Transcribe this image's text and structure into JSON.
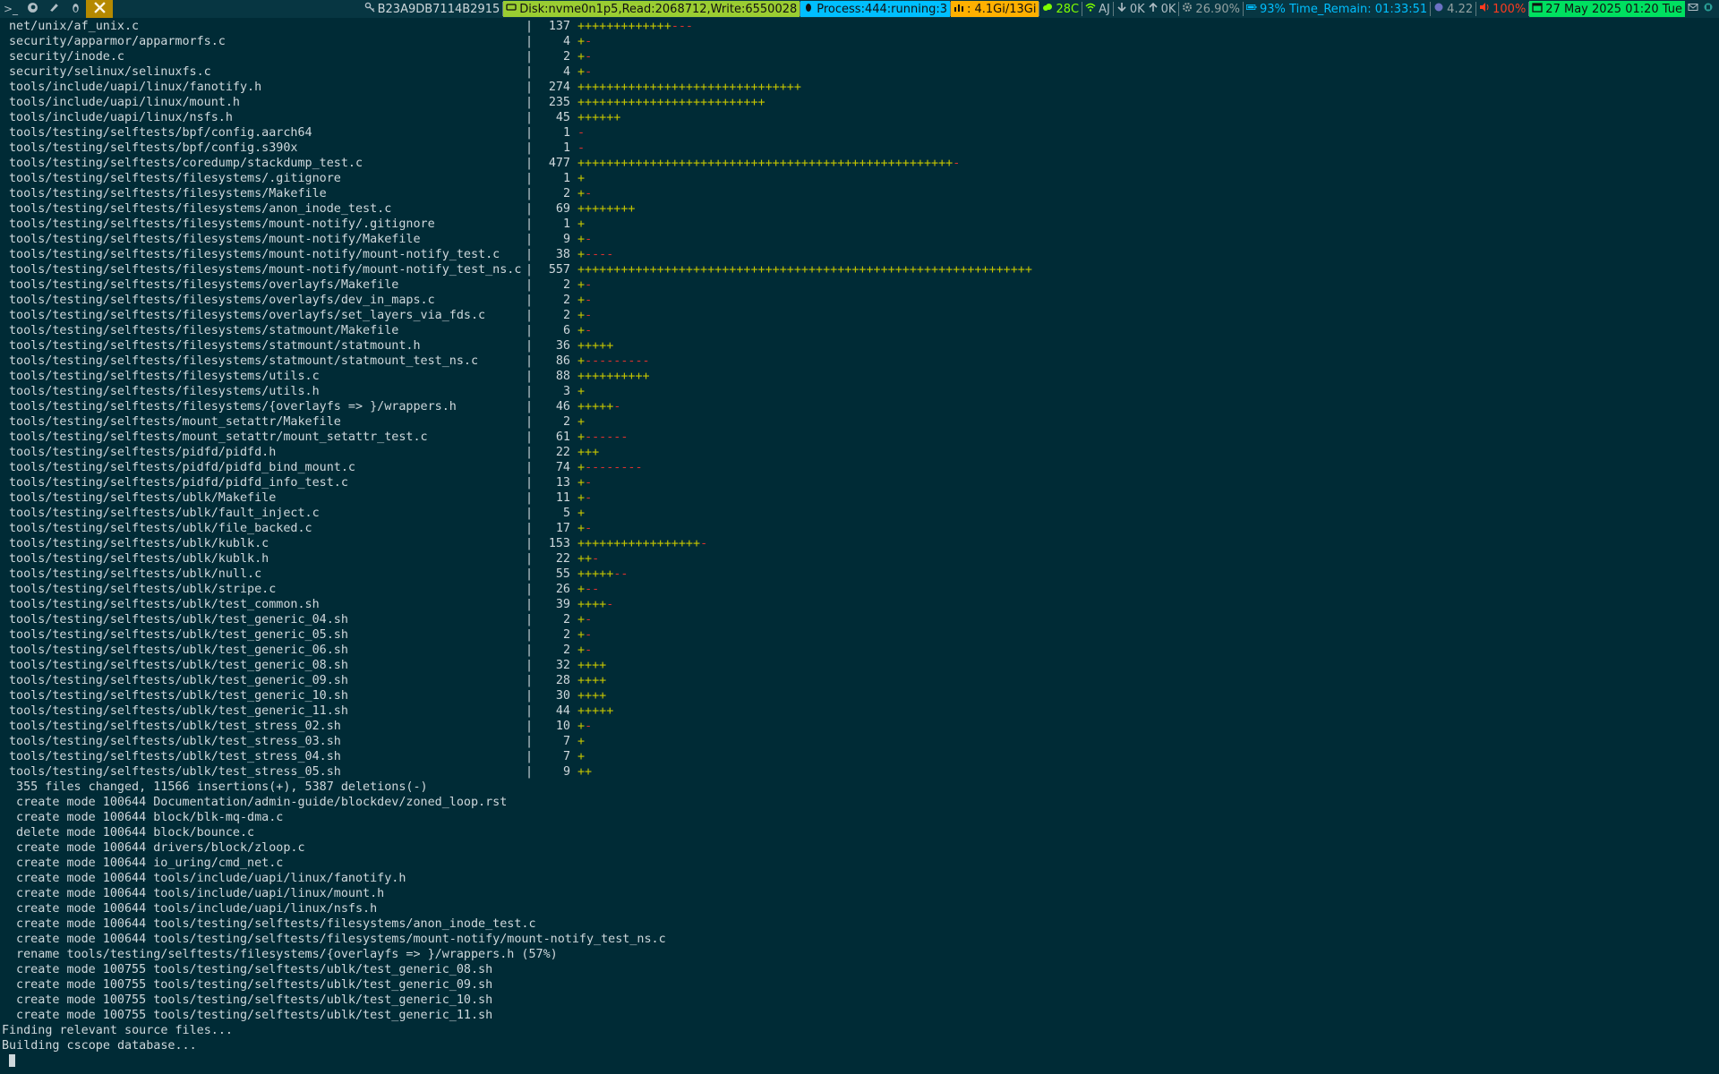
{
  "colors": {
    "background": "#002b36",
    "bar": "#073642",
    "text": "#cfd8dc",
    "plus": "#c6c600",
    "minus": "#dc322f",
    "disk": "#9acd32",
    "process": "#00bfff",
    "memory": "#ffb000",
    "cpu_temp": "#7fff00",
    "battery": "#00bfff",
    "volume": "#ff3b1f",
    "date": "#00e060"
  },
  "topbar": {
    "workspaces": [
      {
        "icon": "terminal-icon",
        "label": ">_"
      },
      {
        "icon": "firefox-icon",
        "label": ""
      },
      {
        "icon": "chat-icon",
        "label": ""
      },
      {
        "icon": "linux-icon",
        "label": ""
      },
      {
        "icon": "tools-icon",
        "label": ""
      }
    ],
    "hostname": "B23A9DB7114B2915",
    "disk": "Disk:nvme0n1p5,Read:2068712,Write:6550028",
    "process": "Process:444:running:3",
    "memory": ": 4.1Gi/13Gi",
    "cpu_temp": "28C",
    "wifi": "AJ",
    "net_down": "0K",
    "net_up": "0K",
    "cpu": "26.90%",
    "battery": "93% Time_Remain: 01:33:51",
    "load": "4.22",
    "volume": "100%",
    "date": "27 May 2025 01:20 Tue"
  },
  "diffstat": [
    {
      "file": "net/unix/af_unix.c",
      "count": "137",
      "plus": "+++++++++++++",
      "minus": "---"
    },
    {
      "file": "security/apparmor/apparmorfs.c",
      "count": "4",
      "plus": "+",
      "minus": "-"
    },
    {
      "file": "security/inode.c",
      "count": "2",
      "plus": "+",
      "minus": "-"
    },
    {
      "file": "security/selinux/selinuxfs.c",
      "count": "4",
      "plus": "+",
      "minus": "-"
    },
    {
      "file": "tools/include/uapi/linux/fanotify.h",
      "count": "274",
      "plus": "+++++++++++++++++++++++++++++++",
      "minus": ""
    },
    {
      "file": "tools/include/uapi/linux/mount.h",
      "count": "235",
      "plus": "++++++++++++++++++++++++++",
      "minus": ""
    },
    {
      "file": "tools/include/uapi/linux/nsfs.h",
      "count": "45",
      "plus": "++++++",
      "minus": ""
    },
    {
      "file": "tools/testing/selftests/bpf/config.aarch64",
      "count": "1",
      "plus": "",
      "minus": "-"
    },
    {
      "file": "tools/testing/selftests/bpf/config.s390x",
      "count": "1",
      "plus": "",
      "minus": "-"
    },
    {
      "file": "tools/testing/selftests/coredump/stackdump_test.c",
      "count": "477",
      "plus": "++++++++++++++++++++++++++++++++++++++++++++++++++++",
      "minus": "-"
    },
    {
      "file": "tools/testing/selftests/filesystems/.gitignore",
      "count": "1",
      "plus": "+",
      "minus": ""
    },
    {
      "file": "tools/testing/selftests/filesystems/Makefile",
      "count": "2",
      "plus": "+",
      "minus": "-"
    },
    {
      "file": "tools/testing/selftests/filesystems/anon_inode_test.c",
      "count": "69",
      "plus": "++++++++",
      "minus": ""
    },
    {
      "file": "tools/testing/selftests/filesystems/mount-notify/.gitignore",
      "count": "1",
      "plus": "+",
      "minus": ""
    },
    {
      "file": "tools/testing/selftests/filesystems/mount-notify/Makefile",
      "count": "9",
      "plus": "+",
      "minus": "-"
    },
    {
      "file": "tools/testing/selftests/filesystems/mount-notify/mount-notify_test.c",
      "count": "38",
      "plus": "+",
      "minus": "----"
    },
    {
      "file": "tools/testing/selftests/filesystems/mount-notify/mount-notify_test_ns.c",
      "count": "557",
      "plus": "+++++++++++++++++++++++++++++++++++++++++++++++++++++++++++++++",
      "minus": ""
    },
    {
      "file": "tools/testing/selftests/filesystems/overlayfs/Makefile",
      "count": "2",
      "plus": "+",
      "minus": "-"
    },
    {
      "file": "tools/testing/selftests/filesystems/overlayfs/dev_in_maps.c",
      "count": "2",
      "plus": "+",
      "minus": "-"
    },
    {
      "file": "tools/testing/selftests/filesystems/overlayfs/set_layers_via_fds.c",
      "count": "2",
      "plus": "+",
      "minus": "-"
    },
    {
      "file": "tools/testing/selftests/filesystems/statmount/Makefile",
      "count": "6",
      "plus": "+",
      "minus": "-"
    },
    {
      "file": "tools/testing/selftests/filesystems/statmount/statmount.h",
      "count": "36",
      "plus": "+++++",
      "minus": ""
    },
    {
      "file": "tools/testing/selftests/filesystems/statmount/statmount_test_ns.c",
      "count": "86",
      "plus": "+",
      "minus": "---------"
    },
    {
      "file": "tools/testing/selftests/filesystems/utils.c",
      "count": "88",
      "plus": "++++++++++",
      "minus": ""
    },
    {
      "file": "tools/testing/selftests/filesystems/utils.h",
      "count": "3",
      "plus": "+",
      "minus": ""
    },
    {
      "file": "tools/testing/selftests/filesystems/{overlayfs => }/wrappers.h",
      "count": "46",
      "plus": "+++++",
      "minus": "-"
    },
    {
      "file": "tools/testing/selftests/mount_setattr/Makefile",
      "count": "2",
      "plus": "+",
      "minus": ""
    },
    {
      "file": "tools/testing/selftests/mount_setattr/mount_setattr_test.c",
      "count": "61",
      "plus": "+",
      "minus": "------"
    },
    {
      "file": "tools/testing/selftests/pidfd/pidfd.h",
      "count": "22",
      "plus": "+++",
      "minus": ""
    },
    {
      "file": "tools/testing/selftests/pidfd/pidfd_bind_mount.c",
      "count": "74",
      "plus": "+",
      "minus": "--------"
    },
    {
      "file": "tools/testing/selftests/pidfd/pidfd_info_test.c",
      "count": "13",
      "plus": "+",
      "minus": "-"
    },
    {
      "file": "tools/testing/selftests/ublk/Makefile",
      "count": "11",
      "plus": "+",
      "minus": "-"
    },
    {
      "file": "tools/testing/selftests/ublk/fault_inject.c",
      "count": "5",
      "plus": "+",
      "minus": ""
    },
    {
      "file": "tools/testing/selftests/ublk/file_backed.c",
      "count": "17",
      "plus": "+",
      "minus": "-"
    },
    {
      "file": "tools/testing/selftests/ublk/kublk.c",
      "count": "153",
      "plus": "+++++++++++++++++",
      "minus": "-"
    },
    {
      "file": "tools/testing/selftests/ublk/kublk.h",
      "count": "22",
      "plus": "++",
      "minus": "-"
    },
    {
      "file": "tools/testing/selftests/ublk/null.c",
      "count": "55",
      "plus": "+++++",
      "minus": "--"
    },
    {
      "file": "tools/testing/selftests/ublk/stripe.c",
      "count": "26",
      "plus": "+",
      "minus": "--"
    },
    {
      "file": "tools/testing/selftests/ublk/test_common.sh",
      "count": "39",
      "plus": "++++",
      "minus": "-"
    },
    {
      "file": "tools/testing/selftests/ublk/test_generic_04.sh",
      "count": "2",
      "plus": "+",
      "minus": "-"
    },
    {
      "file": "tools/testing/selftests/ublk/test_generic_05.sh",
      "count": "2",
      "plus": "+",
      "minus": "-"
    },
    {
      "file": "tools/testing/selftests/ublk/test_generic_06.sh",
      "count": "2",
      "plus": "+",
      "minus": "-"
    },
    {
      "file": "tools/testing/selftests/ublk/test_generic_08.sh",
      "count": "32",
      "plus": "++++",
      "minus": ""
    },
    {
      "file": "tools/testing/selftests/ublk/test_generic_09.sh",
      "count": "28",
      "plus": "++++",
      "minus": ""
    },
    {
      "file": "tools/testing/selftests/ublk/test_generic_10.sh",
      "count": "30",
      "plus": "++++",
      "minus": ""
    },
    {
      "file": "tools/testing/selftests/ublk/test_generic_11.sh",
      "count": "44",
      "plus": "+++++",
      "minus": ""
    },
    {
      "file": "tools/testing/selftests/ublk/test_stress_02.sh",
      "count": "10",
      "plus": "+",
      "minus": "-"
    },
    {
      "file": "tools/testing/selftests/ublk/test_stress_03.sh",
      "count": "7",
      "plus": "+",
      "minus": ""
    },
    {
      "file": "tools/testing/selftests/ublk/test_stress_04.sh",
      "count": "7",
      "plus": "+",
      "minus": ""
    },
    {
      "file": "tools/testing/selftests/ublk/test_stress_05.sh",
      "count": "9",
      "plus": "++",
      "minus": ""
    }
  ],
  "summary_lines": [
    " 355 files changed, 11566 insertions(+), 5387 deletions(-)",
    " create mode 100644 Documentation/admin-guide/blockdev/zoned_loop.rst",
    " create mode 100644 block/blk-mq-dma.c",
    " delete mode 100644 block/bounce.c",
    " create mode 100644 drivers/block/zloop.c",
    " create mode 100644 io_uring/cmd_net.c",
    " create mode 100644 tools/include/uapi/linux/fanotify.h",
    " create mode 100644 tools/include/uapi/linux/mount.h",
    " create mode 100644 tools/include/uapi/linux/nsfs.h",
    " create mode 100644 tools/testing/selftests/filesystems/anon_inode_test.c",
    " create mode 100644 tools/testing/selftests/filesystems/mount-notify/mount-notify_test_ns.c",
    " rename tools/testing/selftests/filesystems/{overlayfs => }/wrappers.h (57%)",
    " create mode 100755 tools/testing/selftests/ublk/test_generic_08.sh",
    " create mode 100755 tools/testing/selftests/ublk/test_generic_09.sh",
    " create mode 100755 tools/testing/selftests/ublk/test_generic_10.sh",
    " create mode 100755 tools/testing/selftests/ublk/test_generic_11.sh",
    "Finding relevant source files...",
    "Building cscope database..."
  ]
}
